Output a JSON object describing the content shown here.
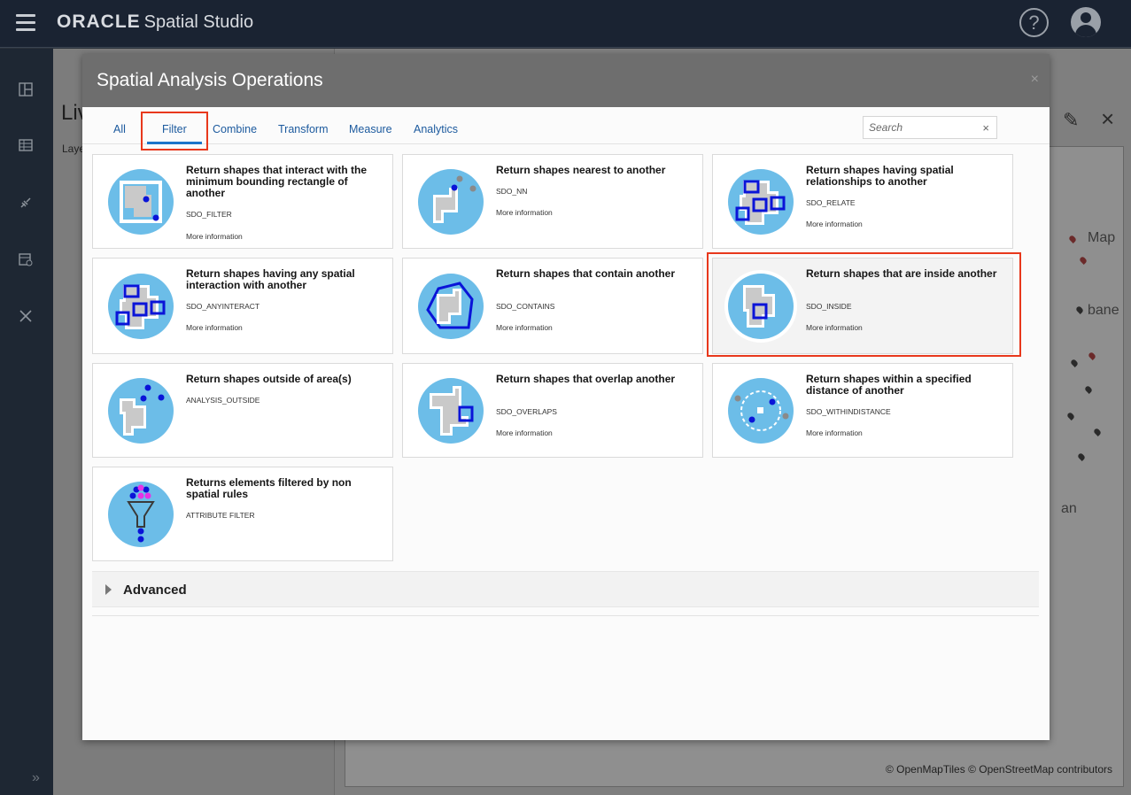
{
  "app": {
    "brand": "ORACLE",
    "product": "Spatial Studio"
  },
  "background": {
    "title": "Liv",
    "layers_label": "Laye",
    "map_labels": [
      "Map",
      "bane",
      "an"
    ],
    "attribution": "© OpenMapTiles  © OpenStreetMap contributors"
  },
  "modal": {
    "title": "Spatial Analysis Operations",
    "close": "×",
    "tabs": [
      {
        "label": "All"
      },
      {
        "label": "Filter",
        "active": true
      },
      {
        "label": "Combine"
      },
      {
        "label": "Transform"
      },
      {
        "label": "Measure"
      },
      {
        "label": "Analytics"
      }
    ],
    "search": {
      "placeholder": "Search",
      "clear": "×"
    },
    "cards": [
      {
        "title": "Return shapes that interact with the minimum bounding rectangle of another",
        "code": "SDO_FILTER",
        "more": "More information",
        "icon": "mbr-filter-icon"
      },
      {
        "title": "Return shapes nearest to another",
        "code": "SDO_NN",
        "more": "More information",
        "icon": "nearest-neighbor-icon"
      },
      {
        "title": "Return shapes having spatial relationships to another",
        "code": "SDO_RELATE",
        "more": "More information",
        "icon": "relate-icon"
      },
      {
        "title": "Return shapes having any spatial interaction with another",
        "code": "SDO_ANYINTERACT",
        "more": "More information",
        "icon": "anyinteract-icon"
      },
      {
        "title": "Return shapes that contain another",
        "code": "SDO_CONTAINS",
        "more": "More information",
        "icon": "contains-icon"
      },
      {
        "title": "Return shapes that are inside another",
        "code": "SDO_INSIDE",
        "more": "More information",
        "icon": "inside-icon",
        "selected": true
      },
      {
        "title": "Return shapes outside of area(s)",
        "code": "ANALYSIS_OUTSIDE",
        "more": "",
        "icon": "outside-icon"
      },
      {
        "title": "Return shapes that overlap another",
        "code": "SDO_OVERLAPS",
        "more": "More information",
        "icon": "overlap-icon"
      },
      {
        "title": "Return shapes within a specified distance of another",
        "code": "SDO_WITHINDISTANCE",
        "more": "More information",
        "icon": "within-distance-icon"
      },
      {
        "title": "Returns elements filtered by non spatial rules",
        "code": "ATTRIBUTE FILTER",
        "more": "",
        "icon": "attribute-filter-icon"
      }
    ],
    "advanced": "Advanced"
  },
  "colors": {
    "icon_bg": "#6cbde8",
    "shape_fill": "#c9c9c9",
    "accent_blue": "#0a14d8",
    "highlight_red": "#e8381c",
    "tab_blue": "#1c5a9e"
  }
}
